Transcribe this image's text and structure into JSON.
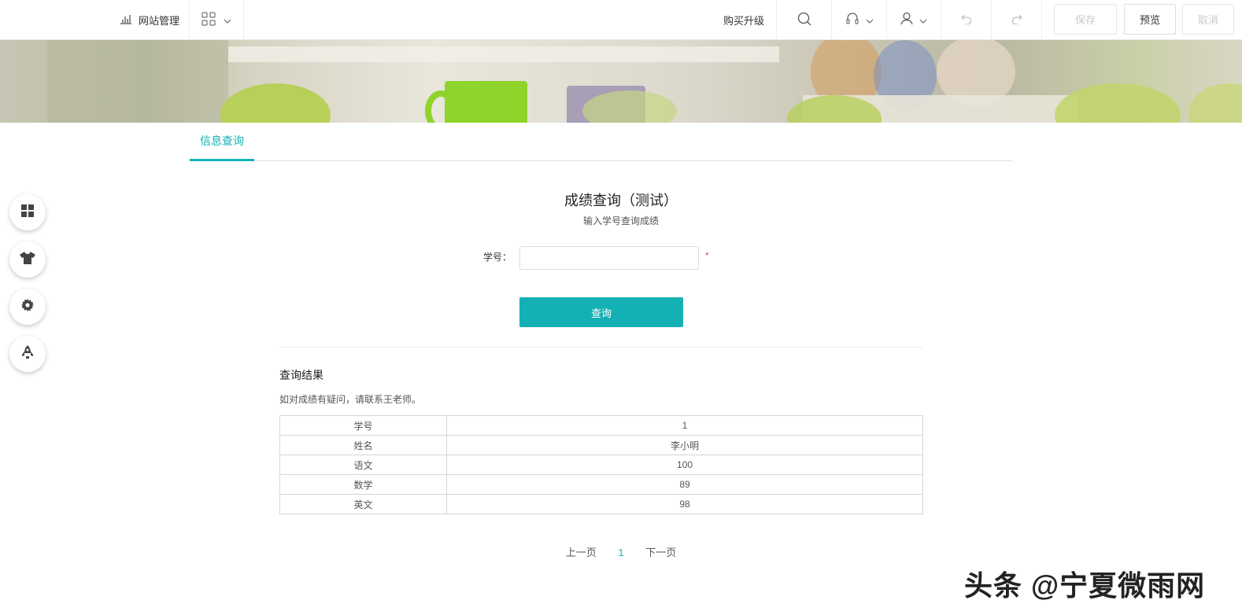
{
  "topbar": {
    "site_manage": "网站管理",
    "buy_upgrade": "购买升级",
    "save": "保存",
    "preview": "预览",
    "cancel": "取消",
    "icons": [
      "bar-chart-icon",
      "grid-icon",
      "search-icon",
      "headset-icon",
      "user-icon",
      "undo-icon",
      "redo-icon"
    ]
  },
  "tabs": {
    "active": "信息查询"
  },
  "sidebar": {
    "icons": [
      "modules-icon",
      "tshirt-icon",
      "gear-icon",
      "rocket-icon"
    ]
  },
  "form": {
    "title": "成绩查询（测试）",
    "subtitle": "输入学号查询成绩",
    "field_label": "学号：",
    "field_value": "",
    "required_mark": "*",
    "query_button": "查询"
  },
  "result": {
    "title": "查询结果",
    "note": "如对成绩有疑问，请联系王老师。",
    "rows": [
      {
        "key": "学号",
        "value": "1"
      },
      {
        "key": "姓名",
        "value": "李小明"
      },
      {
        "key": "语文",
        "value": "100"
      },
      {
        "key": "数学",
        "value": "89"
      },
      {
        "key": "英文",
        "value": "98"
      }
    ]
  },
  "pager": {
    "prev": "上一页",
    "current": "1",
    "next": "下一页"
  },
  "watermark": "头条 @宁夏微雨网",
  "colors": {
    "accent": "#14b1b4",
    "required": "#e0524b"
  }
}
